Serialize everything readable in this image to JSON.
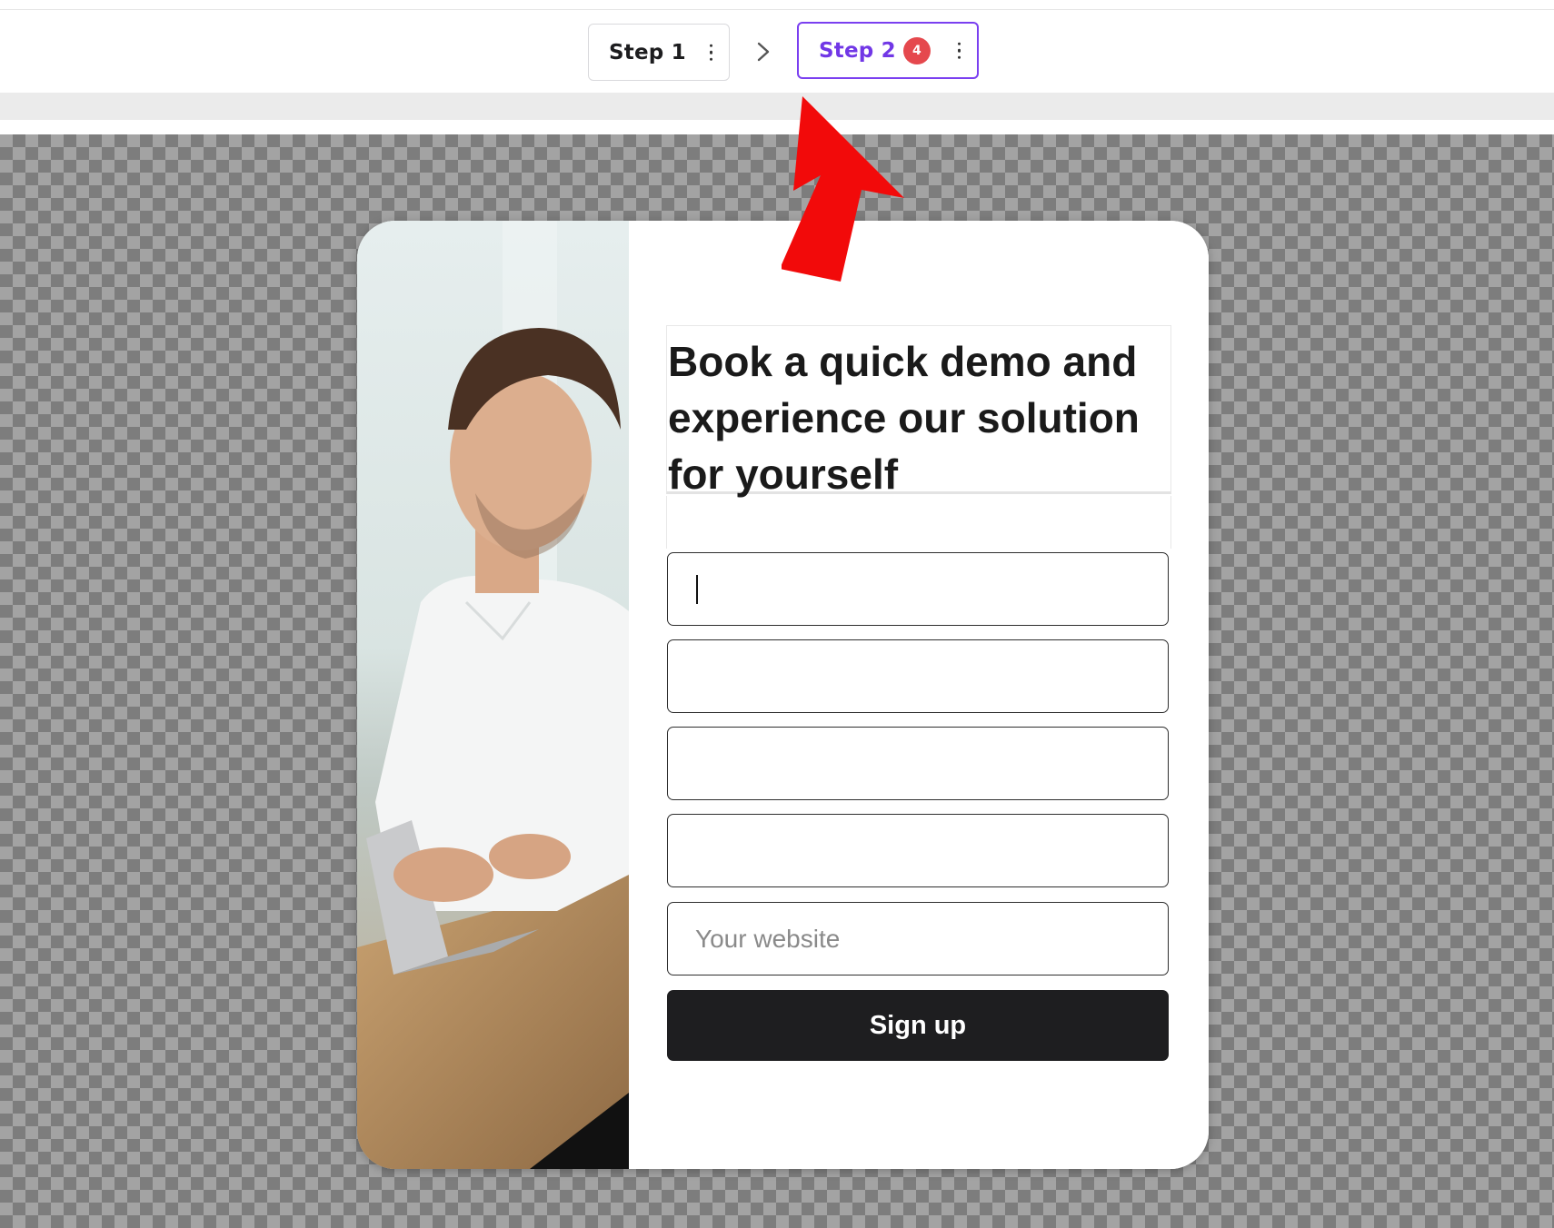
{
  "steps": [
    {
      "label": "Step 1"
    },
    {
      "label": "Step 2",
      "badge": "4"
    }
  ],
  "popup": {
    "headline": "Book a quick demo and experience our solution for yourself",
    "fields": [
      {
        "value": "",
        "placeholder": ""
      },
      {
        "value": "",
        "placeholder": ""
      },
      {
        "value": "",
        "placeholder": ""
      },
      {
        "value": "",
        "placeholder": ""
      },
      {
        "value": "",
        "placeholder": "Your website"
      }
    ],
    "submit_label": "Sign up"
  },
  "colors": {
    "active_step": "#7a3ff0",
    "badge": "#e5484d",
    "button": "#1e1e20",
    "annotation_arrow": "#f20a0a"
  },
  "icons": [
    "kebab-menu-icon",
    "chevron-right-icon",
    "red-arrow-annotation"
  ]
}
